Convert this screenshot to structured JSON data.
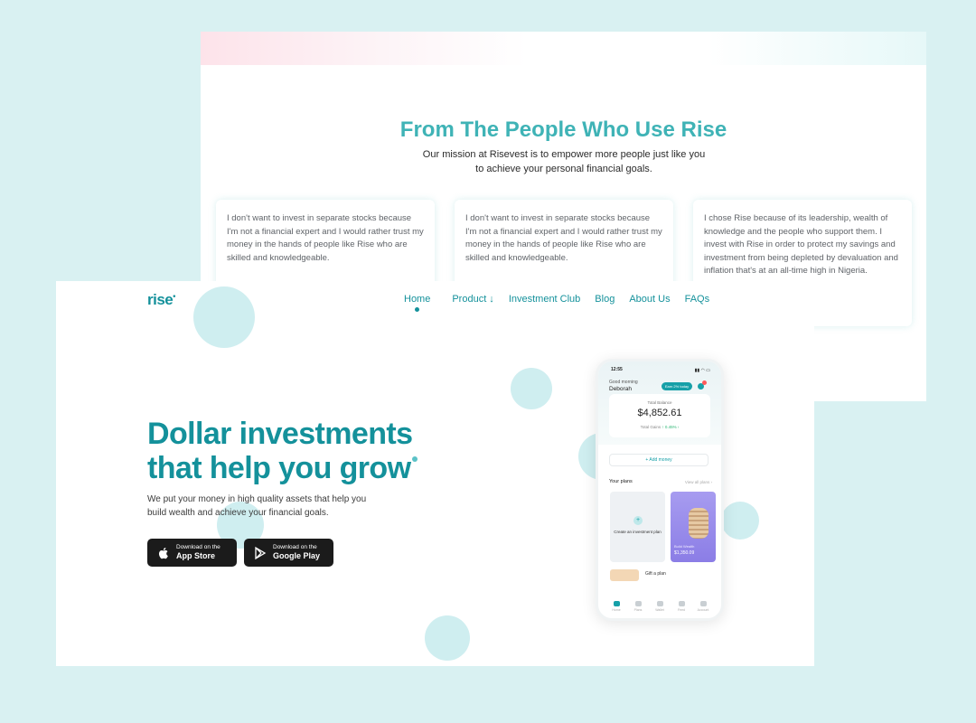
{
  "testimonials": {
    "title": "From The People Who Use Rise",
    "subtitle": "Our mission at Risevest is to empower more people just like you to achieve your personal financial goals.",
    "cards": [
      {
        "text": "I don't want to invest in separate stocks because I'm not a financial expert and I would rather trust my money in the hands of people like Rise who are skilled and knowledgeable."
      },
      {
        "text": "I don't want to invest in separate stocks because I'm not a financial expert and I would rather trust my money in the hands of people like Rise who are skilled and knowledgeable."
      },
      {
        "text": "I chose Rise because of its leadership, wealth of knowledge and the people who support them. I invest with Rise in order to protect my savings and investment from being depleted by devaluation and inflation that's at an all-time high in Nigeria."
      }
    ]
  },
  "header": {
    "logo": "rise",
    "nav": [
      {
        "label": "Home",
        "active": true
      },
      {
        "label": "Product ↓"
      },
      {
        "label": "Investment Club"
      },
      {
        "label": "Blog"
      },
      {
        "label": "About Us"
      },
      {
        "label": "FAQs"
      }
    ]
  },
  "hero": {
    "title_line1": "Dollar investments",
    "title_line2": "that help you grow",
    "subtitle": "We put your money in high quality assets that help you build wealth and achieve your financial goals.",
    "app_store": {
      "small": "Download on the",
      "big": "App Store",
      "icon": "apple-icon"
    },
    "google_play": {
      "small": "Download on the",
      "big": "Google Play",
      "icon": "google-play-icon"
    }
  },
  "phone": {
    "time": "12:55",
    "greeting": "Good morning",
    "name": "Deborah",
    "pill": "Earn 2% today",
    "balance_label": "Total Balance",
    "balance": "$4,852.61",
    "gain_label": "Total Gains",
    "gain_value": "↑ 0.45% ›",
    "add_money": "+ Add money",
    "plans_label": "Your plans",
    "view_all": "View all plans ›",
    "create_plan": "Create an investment plan",
    "plan_name": "Build Wealth",
    "plan_value": "$1,350.09",
    "gift_label": "Gift a plan",
    "tabs": [
      "Home",
      "Plans",
      "Wallet",
      "Feed",
      "Account"
    ]
  },
  "colors": {
    "brand": "#14919b",
    "accent": "#3fb3b6",
    "background": "#d9f1f2"
  }
}
